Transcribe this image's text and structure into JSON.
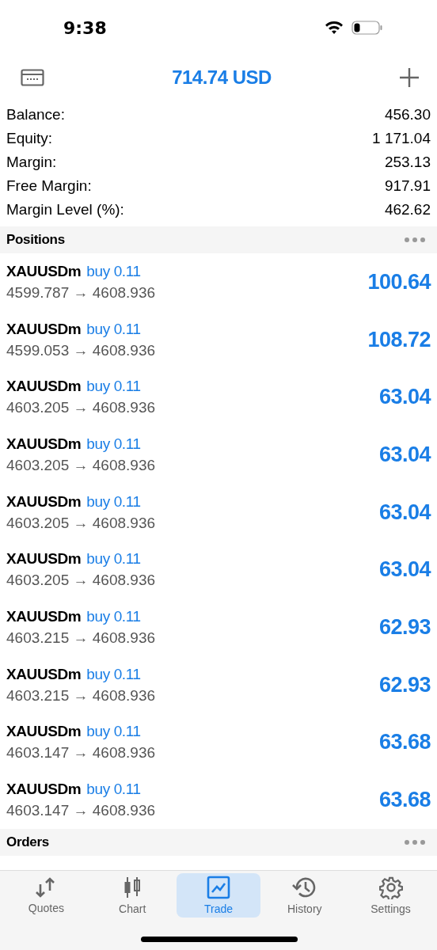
{
  "status_bar": {
    "time": "9:38"
  },
  "header": {
    "title": "714.74 USD"
  },
  "summary": [
    {
      "label": "Balance:",
      "value": "456.30"
    },
    {
      "label": "Equity:",
      "value": "1 171.04"
    },
    {
      "label": "Margin:",
      "value": "253.13"
    },
    {
      "label": "Free Margin:",
      "value": "917.91"
    },
    {
      "label": "Margin Level (%):",
      "value": "462.62"
    }
  ],
  "positions": {
    "title": "Positions",
    "rows": [
      {
        "symbol": "XAUUSDm",
        "side": "buy 0.11",
        "prices": "4599.787 → 4608.936",
        "profit": "100.64"
      },
      {
        "symbol": "XAUUSDm",
        "side": "buy 0.11",
        "prices": "4599.053 → 4608.936",
        "profit": "108.72"
      },
      {
        "symbol": "XAUUSDm",
        "side": "buy 0.11",
        "prices": "4603.205 → 4608.936",
        "profit": "63.04"
      },
      {
        "symbol": "XAUUSDm",
        "side": "buy 0.11",
        "prices": "4603.205 → 4608.936",
        "profit": "63.04"
      },
      {
        "symbol": "XAUUSDm",
        "side": "buy 0.11",
        "prices": "4603.205 → 4608.936",
        "profit": "63.04"
      },
      {
        "symbol": "XAUUSDm",
        "side": "buy 0.11",
        "prices": "4603.205 → 4608.936",
        "profit": "63.04"
      },
      {
        "symbol": "XAUUSDm",
        "side": "buy 0.11",
        "prices": "4603.215 → 4608.936",
        "profit": "62.93"
      },
      {
        "symbol": "XAUUSDm",
        "side": "buy 0.11",
        "prices": "4603.215 → 4608.936",
        "profit": "62.93"
      },
      {
        "symbol": "XAUUSDm",
        "side": "buy 0.11",
        "prices": "4603.147 → 4608.936",
        "profit": "63.68"
      },
      {
        "symbol": "XAUUSDm",
        "side": "buy 0.11",
        "prices": "4603.147 → 4608.936",
        "profit": "63.68"
      }
    ]
  },
  "orders": {
    "title": "Orders"
  },
  "tab_bar": [
    {
      "label": "Quotes",
      "selected": false
    },
    {
      "label": "Chart",
      "selected": false
    },
    {
      "label": "Trade",
      "selected": true
    },
    {
      "label": "History",
      "selected": false
    },
    {
      "label": "Settings",
      "selected": false
    }
  ]
}
